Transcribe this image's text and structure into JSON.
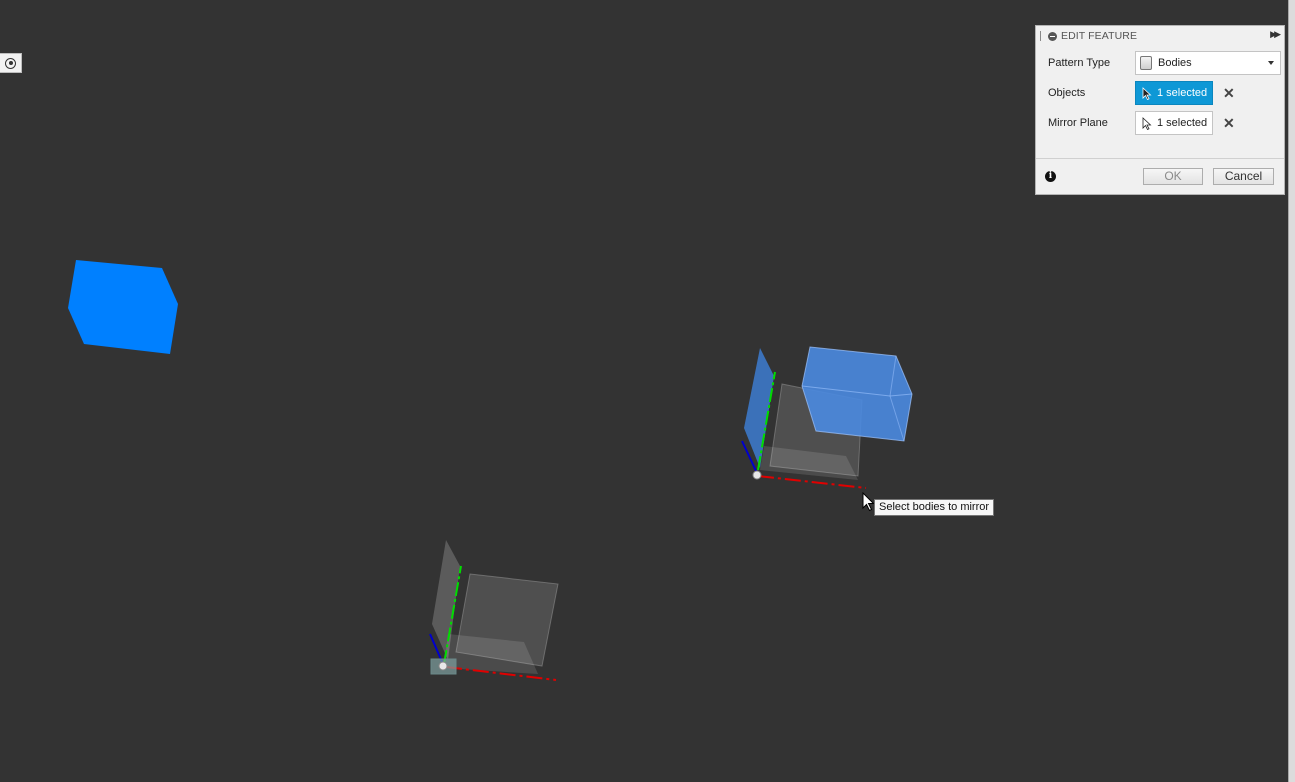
{
  "panel": {
    "title": "EDIT FEATURE",
    "pattern_type_label": "Pattern Type",
    "pattern_type_value": "Bodies",
    "objects_label": "Objects",
    "objects_value": "1 selected",
    "mirror_plane_label": "Mirror Plane",
    "mirror_plane_value": "1 selected",
    "ok_label": "OK",
    "cancel_label": "Cancel"
  },
  "tooltip": {
    "text": "Select bodies to mirror"
  },
  "colors": {
    "viewport_bg": "#333333",
    "selected_body": "#0080ff",
    "selection_accent": "#0e98d6",
    "x_axis": "#e00000",
    "y_axis": "#00cc00",
    "z_axis": "#0000cc"
  },
  "icons": {
    "collapse": "minus-circle-icon",
    "expand": "double-chevron-right-icon",
    "pattern_type": "bodies-icon",
    "selection": "arrow-cursor-icon",
    "clear": "close-icon",
    "info": "info-icon"
  }
}
